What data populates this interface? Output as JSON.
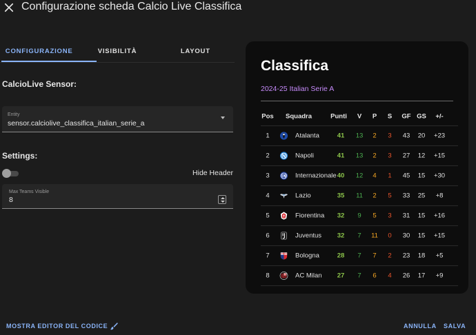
{
  "dialog": {
    "title": "Configurazione scheda Calcio Live Classifica"
  },
  "tabs": [
    {
      "label": "CONFIGURAZIONE",
      "active": true
    },
    {
      "label": "VISIBILITÀ",
      "active": false
    },
    {
      "label": "LAYOUT",
      "active": false
    }
  ],
  "config": {
    "sensor_section": "CalcioLive Sensor:",
    "entity_label": "Entity",
    "entity_value": "sensor.calciolive_classifica_italian_serie_a",
    "settings_section": "Settings:",
    "hide_header_label": "Hide Header",
    "hide_header_on": false,
    "max_teams_label": "Max Teams Visible",
    "max_teams_value": "8"
  },
  "card": {
    "title": "Classifica",
    "subtitle": "2024-25 Italian Serie A",
    "columns": [
      "Pos",
      "Squadra",
      "Punti",
      "V",
      "P",
      "S",
      "GF",
      "GS",
      "+/-"
    ],
    "rows": [
      {
        "pos": "1",
        "team": "Atalanta",
        "logo": "atalanta-logo-icon",
        "pts": "41",
        "v": "13",
        "p": "2",
        "s": "3",
        "gf": "43",
        "gs": "20",
        "gd": "+23"
      },
      {
        "pos": "2",
        "team": "Napoli",
        "logo": "napoli-logo-icon",
        "pts": "41",
        "v": "13",
        "p": "2",
        "s": "3",
        "gf": "27",
        "gs": "12",
        "gd": "+15"
      },
      {
        "pos": "3",
        "team": "Internazionale",
        "logo": "inter-logo-icon",
        "pts": "40",
        "v": "12",
        "p": "4",
        "s": "1",
        "gf": "45",
        "gs": "15",
        "gd": "+30"
      },
      {
        "pos": "4",
        "team": "Lazio",
        "logo": "lazio-logo-icon",
        "pts": "35",
        "v": "11",
        "p": "2",
        "s": "5",
        "gf": "33",
        "gs": "25",
        "gd": "+8"
      },
      {
        "pos": "5",
        "team": "Fiorentina",
        "logo": "fiorentina-logo-icon",
        "pts": "32",
        "v": "9",
        "p": "5",
        "s": "3",
        "gf": "31",
        "gs": "15",
        "gd": "+16"
      },
      {
        "pos": "6",
        "team": "Juventus",
        "logo": "juventus-logo-icon",
        "pts": "32",
        "v": "7",
        "p": "11",
        "s": "0",
        "gf": "30",
        "gs": "15",
        "gd": "+15"
      },
      {
        "pos": "7",
        "team": "Bologna",
        "logo": "bologna-logo-icon",
        "pts": "28",
        "v": "7",
        "p": "7",
        "s": "2",
        "gf": "23",
        "gs": "18",
        "gd": "+5"
      },
      {
        "pos": "8",
        "team": "AC Milan",
        "logo": "milan-logo-icon",
        "pts": "27",
        "v": "7",
        "p": "6",
        "s": "4",
        "gf": "26",
        "gs": "17",
        "gd": "+9"
      }
    ]
  },
  "footer": {
    "show_code_editor": "MOSTRA EDITOR DEL CODICE",
    "cancel": "ANNULLA",
    "save": "SALVA"
  },
  "colors": {
    "accent": "#8ab4f8",
    "subtitle": "#c58af9",
    "points": "#8bc34a",
    "wins": "#4caf50",
    "draws": "#f5a623",
    "losses": "#e8542c"
  }
}
